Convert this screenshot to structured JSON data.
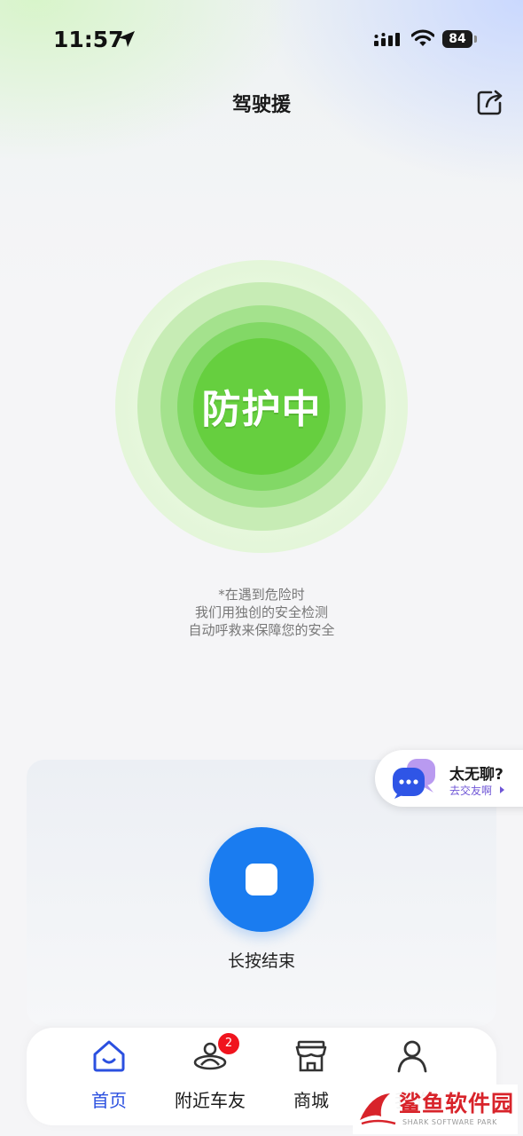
{
  "status_bar": {
    "time": "11:57",
    "battery": "84"
  },
  "header": {
    "title": "驾驶援"
  },
  "protection": {
    "status": "防护中"
  },
  "hint_lines": [
    "*在遇到危险时",
    "我们用独创的安全检测",
    "自动呼救来保障您的安全"
  ],
  "control": {
    "stop_label": "长按结束"
  },
  "chat_float": {
    "title": "太无聊?",
    "subtitle": "去交友啊"
  },
  "tabs": [
    {
      "label": "首页",
      "icon": "home-icon",
      "active": true
    },
    {
      "label": "附近车友",
      "icon": "nearby-user-icon",
      "badge": "2"
    },
    {
      "label": "商城",
      "icon": "store-icon"
    },
    {
      "label": "我的",
      "icon": "profile-icon"
    }
  ],
  "watermark": {
    "text": "鲨鱼软件园",
    "sub": "SHARK SOFTWARE PARK"
  },
  "colors": {
    "accent_blue": "#1a7cf0",
    "tab_active": "#2b50e0",
    "green": "#66cf3f",
    "badge_red": "#f0141e"
  }
}
